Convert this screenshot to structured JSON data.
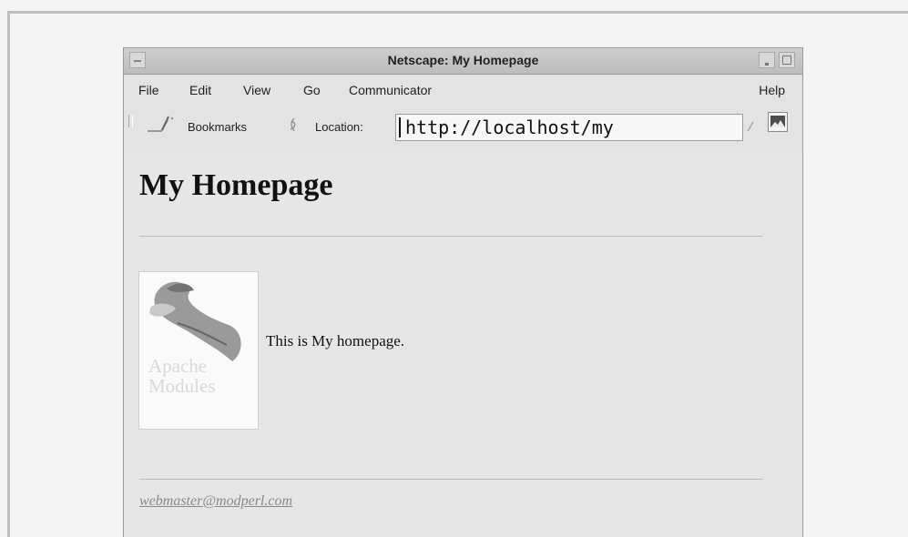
{
  "window": {
    "title": "Netscape: My Homepage"
  },
  "menu": {
    "file": "File",
    "edit": "Edit",
    "view": "View",
    "go": "Go",
    "communicator": "Communicator",
    "help": "Help"
  },
  "toolbar": {
    "bookmarks_label": "Bookmarks",
    "location_label": "Location:",
    "location_value": "http://localhost/my"
  },
  "page": {
    "title": "My Homepage",
    "image_title": "Apache Modules",
    "intro": "This is My homepage.",
    "email": "webmaster@modperl.com"
  },
  "colors": {
    "window_bg": "#e6e6e6",
    "titlebar_bg": "#c8c8c8",
    "link": "#8a8a8a"
  },
  "icons": {
    "bookmarks": "bookmarks-icon",
    "location": "location-icon",
    "dropdown": "chevron-down-icon",
    "netscape": "netscape-icon"
  }
}
